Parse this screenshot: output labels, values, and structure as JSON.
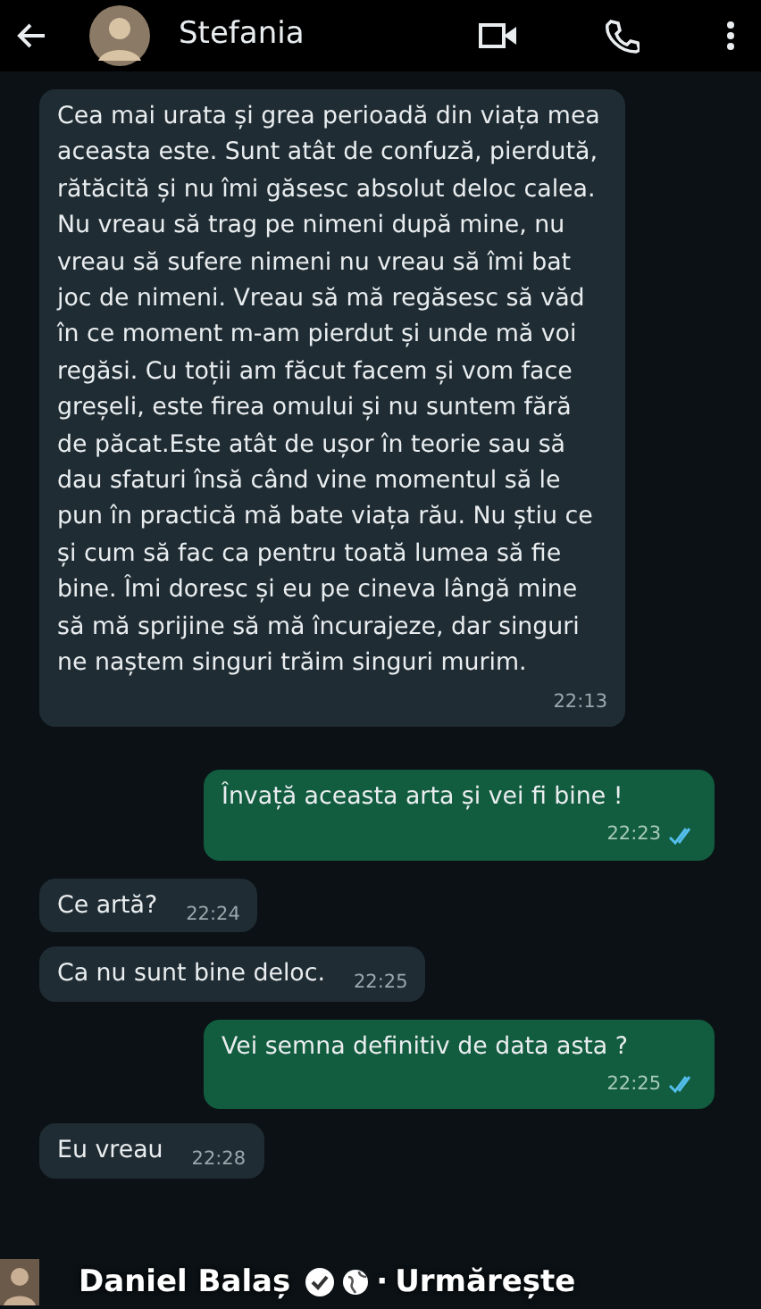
{
  "header": {
    "title": "Stefania"
  },
  "messages": [
    {
      "kind": "received",
      "text": "Cea mai urata și grea perioadă din viața mea aceasta este. Sunt atât de confuză, pierdută, rătăcită și nu îmi găsesc absolut deloc calea. Nu vreau să trag pe nimeni după mine, nu vreau să sufere nimeni nu vreau să îmi bat joc de nimeni. Vreau să mă regăsesc să văd în ce moment m-am pierdut și unde mă voi regăsi. Cu toții am făcut facem și vom face greșeli, este firea omului și nu suntem fără de păcat.Este atât de ușor în teorie sau să dau sfaturi însă când vine momentul să le pun în practică mă bate viața rău. Nu știu ce și cum să fac ca pentru toată lumea să fie bine. Îmi doresc și eu pe cineva lângă mine să mă sprijine să mă încurajeze, dar singuri ne naștem singuri trăim singuri murim.",
      "time": "22:13"
    },
    {
      "kind": "sent",
      "text": "Învață aceasta arta și vei fi bine !",
      "time": "22:23",
      "read": true
    },
    {
      "kind": "received",
      "text": "Ce artă?",
      "time": "22:24"
    },
    {
      "kind": "received",
      "text": "Ca nu sunt bine deloc.",
      "time": "22:25"
    },
    {
      "kind": "sent",
      "text": "Vei semna definitiv de data asta ?",
      "time": "22:25",
      "read": true
    },
    {
      "kind": "received",
      "text": "Eu vreau",
      "time": "22:28"
    }
  ],
  "footer": {
    "author": "Daniel Balaș",
    "verified": true,
    "separator": "·",
    "action": "Urmărește"
  }
}
